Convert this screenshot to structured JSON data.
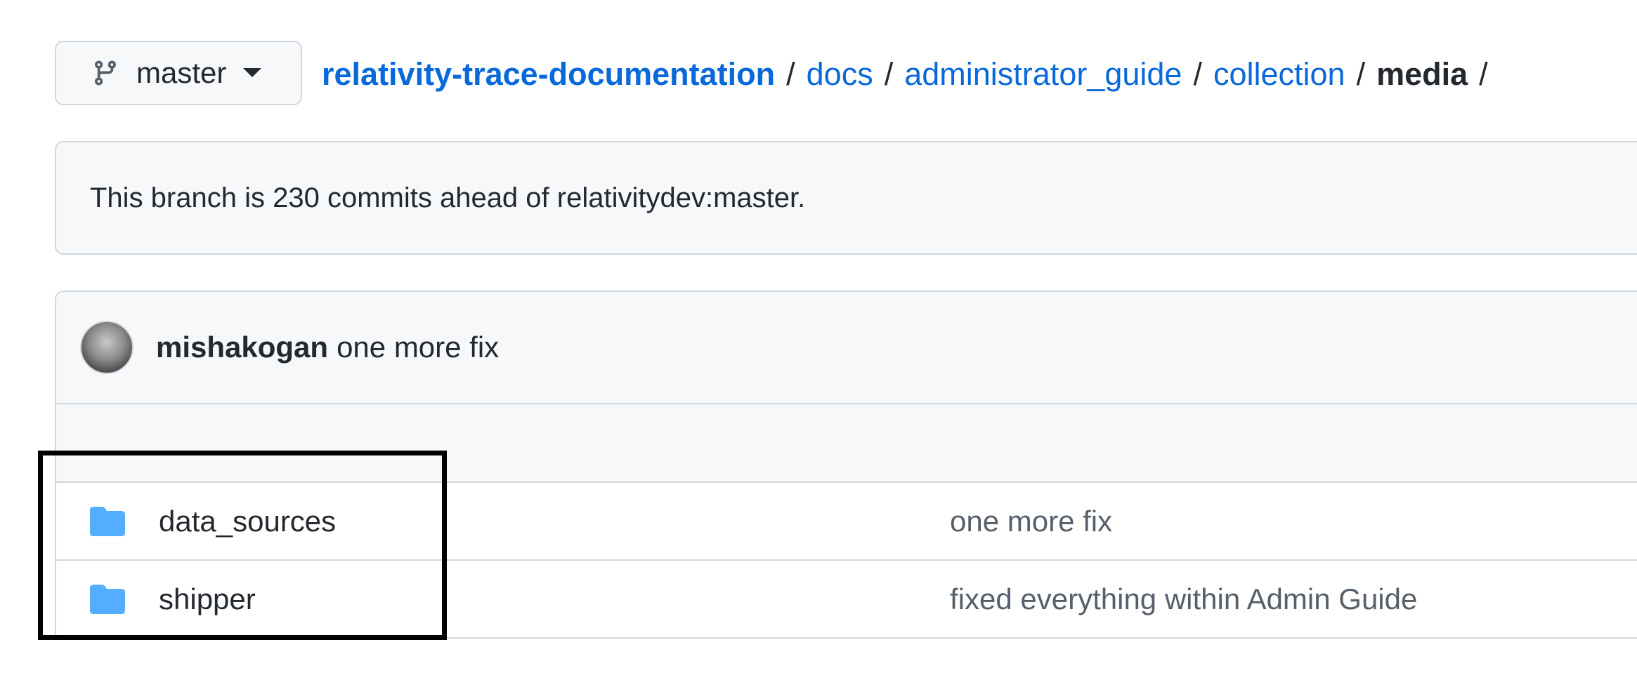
{
  "branch": {
    "name": "master",
    "icon": "git-branch-icon",
    "caret_icon": "triangle-down-icon"
  },
  "breadcrumb": {
    "repo": "relativity-trace-documentation",
    "segments": [
      "docs",
      "administrator_guide",
      "collection"
    ],
    "current": "media",
    "separator": "/"
  },
  "notice": {
    "text": "This branch is 230 commits ahead of relativitydev:master."
  },
  "latest_commit": {
    "author": "mishakogan",
    "message": "one more fix",
    "avatar_icon": "user-avatar"
  },
  "files": [
    {
      "name": "data_sources",
      "commit_message": "one more fix",
      "icon": "folder-icon"
    },
    {
      "name": "shipper",
      "commit_message": "fixed everything within Admin Guide",
      "icon": "folder-icon"
    }
  ],
  "colors": {
    "link": "#0969da",
    "folder": "#54aeff",
    "border": "#d0d7de",
    "muted_bg": "#f6f8fa",
    "highlight": "#000000"
  }
}
